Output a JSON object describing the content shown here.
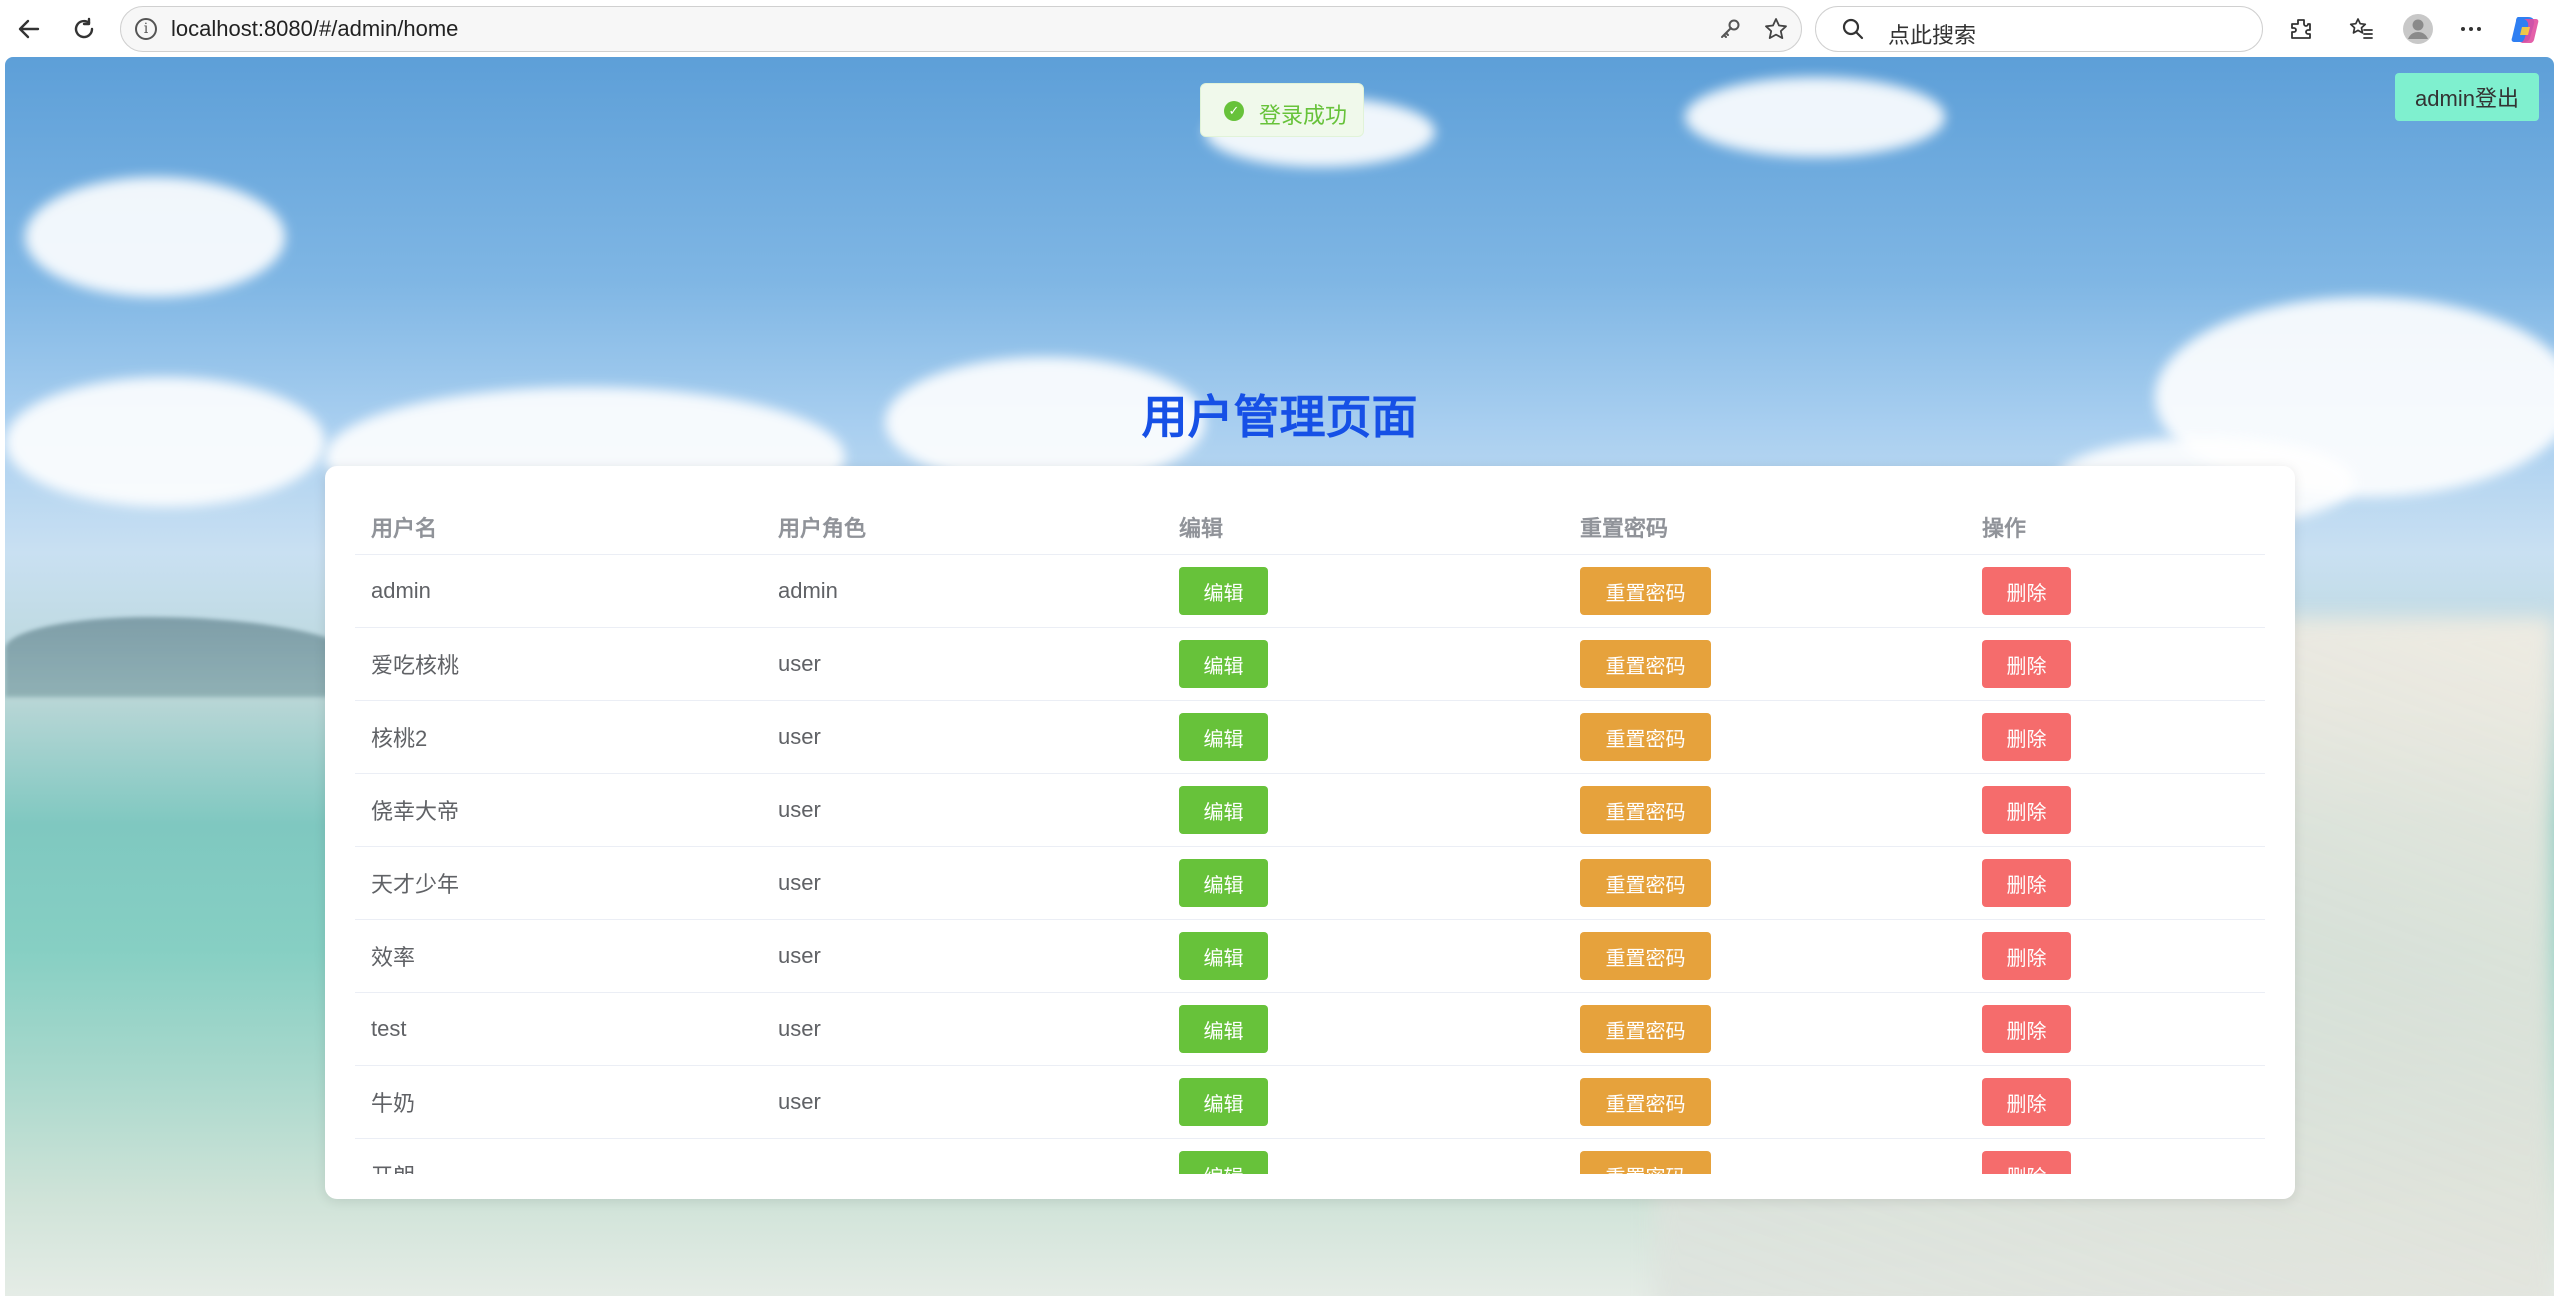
{
  "browser": {
    "url": "localhost:8080/#/admin/home",
    "search_placeholder": "点此搜索"
  },
  "toast": {
    "message": "登录成功"
  },
  "header": {
    "logout_label": "admin登出"
  },
  "page": {
    "title": "用户管理页面"
  },
  "table": {
    "columns": [
      "用户名",
      "用户角色",
      "编辑",
      "重置密码",
      "操作"
    ],
    "rows": [
      {
        "username": "admin",
        "role": "admin"
      },
      {
        "username": "爱吃核桃",
        "role": "user"
      },
      {
        "username": "核桃2",
        "role": "user"
      },
      {
        "username": "侥幸大帝",
        "role": "user"
      },
      {
        "username": "天才少年",
        "role": "user"
      },
      {
        "username": "效率",
        "role": "user"
      },
      {
        "username": "test",
        "role": "user"
      },
      {
        "username": "牛奶",
        "role": "user"
      },
      {
        "username": "开朗",
        "role": ""
      }
    ],
    "edit_label": "编辑",
    "reset_label": "重置密码",
    "delete_label": "删除"
  },
  "colors": {
    "title": "#1650e6",
    "edit": "#67c23a",
    "reset": "#e6a23c",
    "delete": "#f56c6c",
    "logout": "#7ff0cf"
  }
}
